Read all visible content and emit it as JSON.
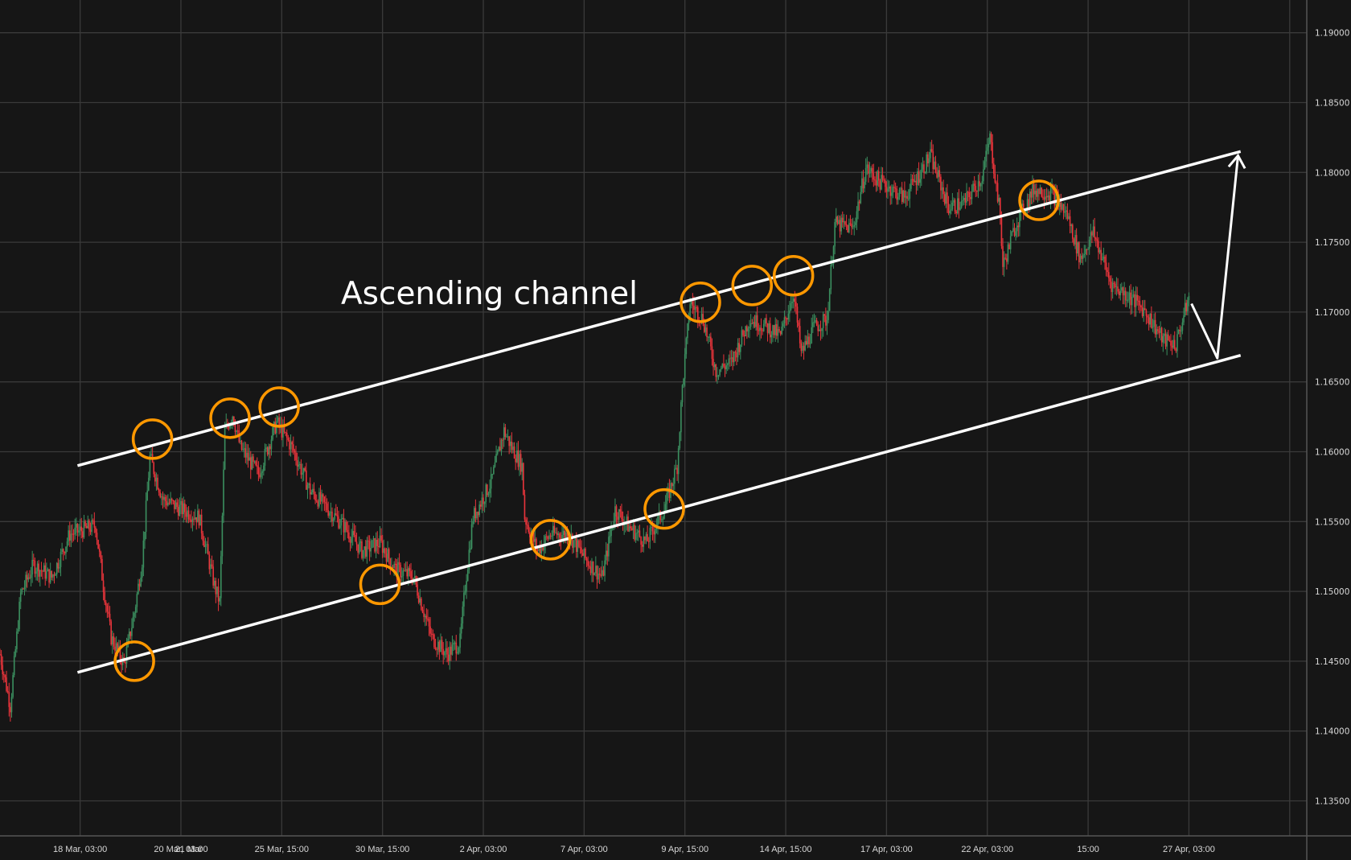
{
  "chart_data": {
    "type": "candlestick",
    "title": "Ascending channel",
    "x_unit": "bar index",
    "y_ticks": [
      "1.19000",
      "1.18500",
      "1.18000",
      "1.17500",
      "1.17000",
      "1.16500",
      "1.16000",
      "1.15500",
      "1.15000",
      "1.14500",
      "1.14000",
      "1.13500"
    ],
    "ylim": [
      1.133,
      1.1925
    ],
    "x_ticks": [
      {
        "bar": 31,
        "label": "18 Mar, 03:00"
      },
      {
        "bar": 70,
        "label": "20 Mar, 03:00"
      },
      {
        "bar": 73,
        "label": "21 Mar"
      },
      {
        "bar": 109,
        "label": "25 Mar, 15:00"
      },
      {
        "bar": 148,
        "label": "30 Mar, 15:00"
      },
      {
        "bar": 187,
        "label": "2 Apr, 03:00"
      },
      {
        "bar": 226,
        "label": "7 Apr, 03:00"
      },
      {
        "bar": 265,
        "label": "9 Apr, 15:00"
      },
      {
        "bar": 304,
        "label": "14 Apr, 15:00"
      },
      {
        "bar": 343,
        "label": "17 Apr, 03:00"
      },
      {
        "bar": 382,
        "label": "22 Apr, 03:00"
      },
      {
        "bar": 421,
        "label": "15:00"
      },
      {
        "bar": 460,
        "label": "27 Apr, 03:00"
      }
    ],
    "grid_bars": [
      31,
      70,
      109,
      148,
      187,
      226,
      265,
      304,
      343,
      382,
      421,
      460,
      499
    ],
    "price_path": [
      [
        0,
        1.1455
      ],
      [
        4,
        1.1418
      ],
      [
        8,
        1.1498
      ],
      [
        13,
        1.1519
      ],
      [
        20,
        1.151
      ],
      [
        27,
        1.1541
      ],
      [
        37,
        1.1547
      ],
      [
        40,
        1.1504
      ],
      [
        43,
        1.1467
      ],
      [
        48,
        1.1448
      ],
      [
        52,
        1.1485
      ],
      [
        55,
        1.1522
      ],
      [
        58,
        1.1596
      ],
      [
        63,
        1.1566
      ],
      [
        70,
        1.1559
      ],
      [
        77,
        1.1553
      ],
      [
        83,
        1.1504
      ],
      [
        85,
        1.1492
      ],
      [
        87,
        1.1615
      ],
      [
        90,
        1.1627
      ],
      [
        93,
        1.1603
      ],
      [
        100,
        1.1584
      ],
      [
        107,
        1.1621
      ],
      [
        113,
        1.1603
      ],
      [
        120,
        1.1572
      ],
      [
        127,
        1.1559
      ],
      [
        133,
        1.1547
      ],
      [
        140,
        1.1529
      ],
      [
        147,
        1.1535
      ],
      [
        153,
        1.1516
      ],
      [
        160,
        1.151
      ],
      [
        167,
        1.1467
      ],
      [
        173,
        1.1455
      ],
      [
        178,
        1.1464
      ],
      [
        180,
        1.1504
      ],
      [
        183,
        1.1553
      ],
      [
        190,
        1.1578
      ],
      [
        195,
        1.1615
      ],
      [
        198,
        1.1603
      ],
      [
        202,
        1.159
      ],
      [
        203,
        1.1553
      ],
      [
        208,
        1.1529
      ],
      [
        213,
        1.1541
      ],
      [
        220,
        1.1541
      ],
      [
        227,
        1.1522
      ],
      [
        233,
        1.151
      ],
      [
        238,
        1.1559
      ],
      [
        243,
        1.1547
      ],
      [
        250,
        1.1535
      ],
      [
        257,
        1.1559
      ],
      [
        262,
        1.159
      ],
      [
        264,
        1.1646
      ],
      [
        267,
        1.1707
      ],
      [
        272,
        1.1695
      ],
      [
        277,
        1.1658
      ],
      [
        283,
        1.1664
      ],
      [
        290,
        1.1695
      ],
      [
        297,
        1.1689
      ],
      [
        302,
        1.1683
      ],
      [
        307,
        1.1714
      ],
      [
        310,
        1.167
      ],
      [
        315,
        1.1689
      ],
      [
        320,
        1.1695
      ],
      [
        323,
        1.1763
      ],
      [
        330,
        1.176
      ],
      [
        335,
        1.1803
      ],
      [
        340,
        1.1794
      ],
      [
        350,
        1.1782
      ],
      [
        360,
        1.1812
      ],
      [
        367,
        1.1775
      ],
      [
        373,
        1.1778
      ],
      [
        380,
        1.1797
      ],
      [
        383,
        1.1825
      ],
      [
        387,
        1.1769
      ],
      [
        388,
        1.1732
      ],
      [
        393,
        1.1763
      ],
      [
        400,
        1.1788
      ],
      [
        407,
        1.1785
      ],
      [
        413,
        1.1769
      ],
      [
        418,
        1.1738
      ],
      [
        423,
        1.1757
      ],
      [
        430,
        1.172
      ],
      [
        437,
        1.1711
      ],
      [
        443,
        1.1701
      ],
      [
        450,
        1.168
      ],
      [
        455,
        1.1677
      ],
      [
        460,
        1.1711
      ]
    ],
    "colors": {
      "up": "#3b8f5f",
      "down": "#e8343b",
      "circle": "#ff9800",
      "line": "#ffffff",
      "grid": "#3a3a3a",
      "background": "#161616"
    },
    "channel": {
      "upper": [
        [
          30,
          1.159
        ],
        [
          480,
          1.1815
        ]
      ],
      "lower": [
        [
          30,
          1.1442
        ],
        [
          480,
          1.1669
        ]
      ]
    },
    "projection_arrow": [
      [
        461,
        1.1706
      ],
      [
        471,
        1.1667
      ],
      [
        479,
        1.1812
      ]
    ],
    "touch_points": [
      [
        59,
        1.1609
      ],
      [
        89,
        1.1624
      ],
      [
        108,
        1.1632
      ],
      [
        52,
        1.145
      ],
      [
        147,
        1.1505
      ],
      [
        213,
        1.1537
      ],
      [
        257,
        1.1559
      ],
      [
        271,
        1.1707
      ],
      [
        291,
        1.1719
      ],
      [
        307,
        1.1726
      ],
      [
        402,
        1.178
      ]
    ]
  }
}
